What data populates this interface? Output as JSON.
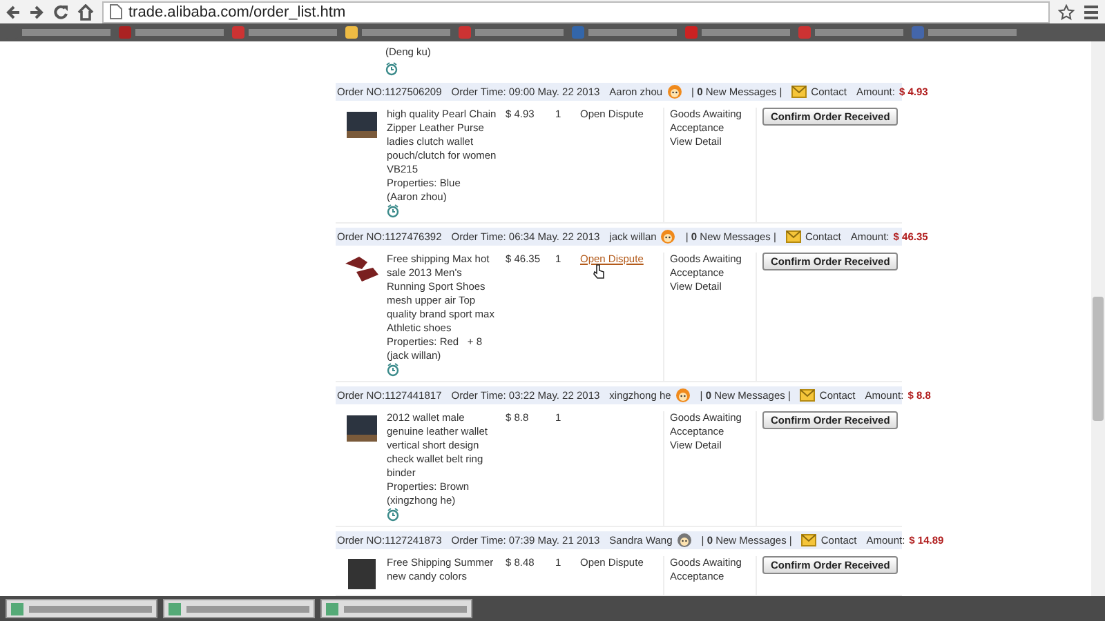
{
  "browser": {
    "url": "trade.alibaba.com/order_list.htm"
  },
  "previous_order": {
    "buyer_note": "(Deng ku)"
  },
  "orders": [
    {
      "order_no": "Order NO:1127506209",
      "order_time": "Order Time: 09:00 May. 22 2013",
      "buyer": "Aaron zhou",
      "buyer_online": true,
      "messages": "| **0** New Messages |",
      "contact": "Contact",
      "amount_label": "Amount:",
      "amount": "$ 4.93",
      "item": {
        "kind": "wallet",
        "description": "high quality Pearl Chain Zipper Leather Purse ladies clutch wallet pouch/clutch for women VB215",
        "properties": "Properties: Blue",
        "buyer_note": "(Aaron zhou)",
        "price": "$ 4.93",
        "quantity": "1",
        "dispute": "Open Dispute",
        "dispute_hovered": false,
        "status": "Goods Awaiting Acceptance",
        "view_detail": "View Detail",
        "button": "Confirm Order Received"
      }
    },
    {
      "order_no": "Order NO:1127476392",
      "order_time": "Order Time: 06:34 May. 22 2013",
      "buyer": "jack willan",
      "buyer_online": true,
      "messages": "| **0** New Messages |",
      "contact": "Contact",
      "amount_label": "Amount:",
      "amount": "$ 46.35",
      "item": {
        "kind": "shoes",
        "description": "Free shipping Max hot sale 2013 Men's Running Sport Shoes mesh upper air Top quality brand sport max Athletic shoes",
        "properties": "Properties: Red   + 8",
        "buyer_note": "(jack willan)",
        "price": "$ 46.35",
        "quantity": "1",
        "dispute": "Open Dispute",
        "dispute_hovered": true,
        "status": "Goods Awaiting Acceptance",
        "view_detail": "View Detail",
        "button": "Confirm Order Received"
      }
    },
    {
      "order_no": "Order NO:1127441817",
      "order_time": "Order Time: 03:22 May. 22 2013",
      "buyer": "xingzhong he",
      "buyer_online": true,
      "messages": "| **0** New Messages |",
      "contact": "Contact",
      "amount_label": "Amount:",
      "amount": "$ 8.8",
      "item": {
        "kind": "wallet",
        "description": "2012 wallet male genuine leather wallet vertical short design check wallet belt ring binder",
        "properties": "Properties: Brown",
        "buyer_note": "(xingzhong he)",
        "price": "$ 8.8",
        "quantity": "1",
        "status": "Goods Awaiting Acceptance",
        "view_detail": "View Detail",
        "button": "Confirm Order Received"
      }
    },
    {
      "order_no": "Order NO:1127241873",
      "order_time": "Order Time: 07:39 May. 21 2013",
      "buyer": "Sandra Wang",
      "buyer_online": false,
      "messages": "| **0** New Messages |",
      "contact": "Contact",
      "amount_label": "Amount:",
      "amount": "$ 14.89",
      "item": {
        "kind": "bag",
        "description": "Free Shipping Summer new candy colors",
        "price": "$ 8.48",
        "quantity": "1",
        "dispute": "Open Dispute",
        "dispute_hovered": false,
        "status": "Goods Awaiting Acceptance",
        "button": "Confirm Order Received"
      }
    }
  ]
}
